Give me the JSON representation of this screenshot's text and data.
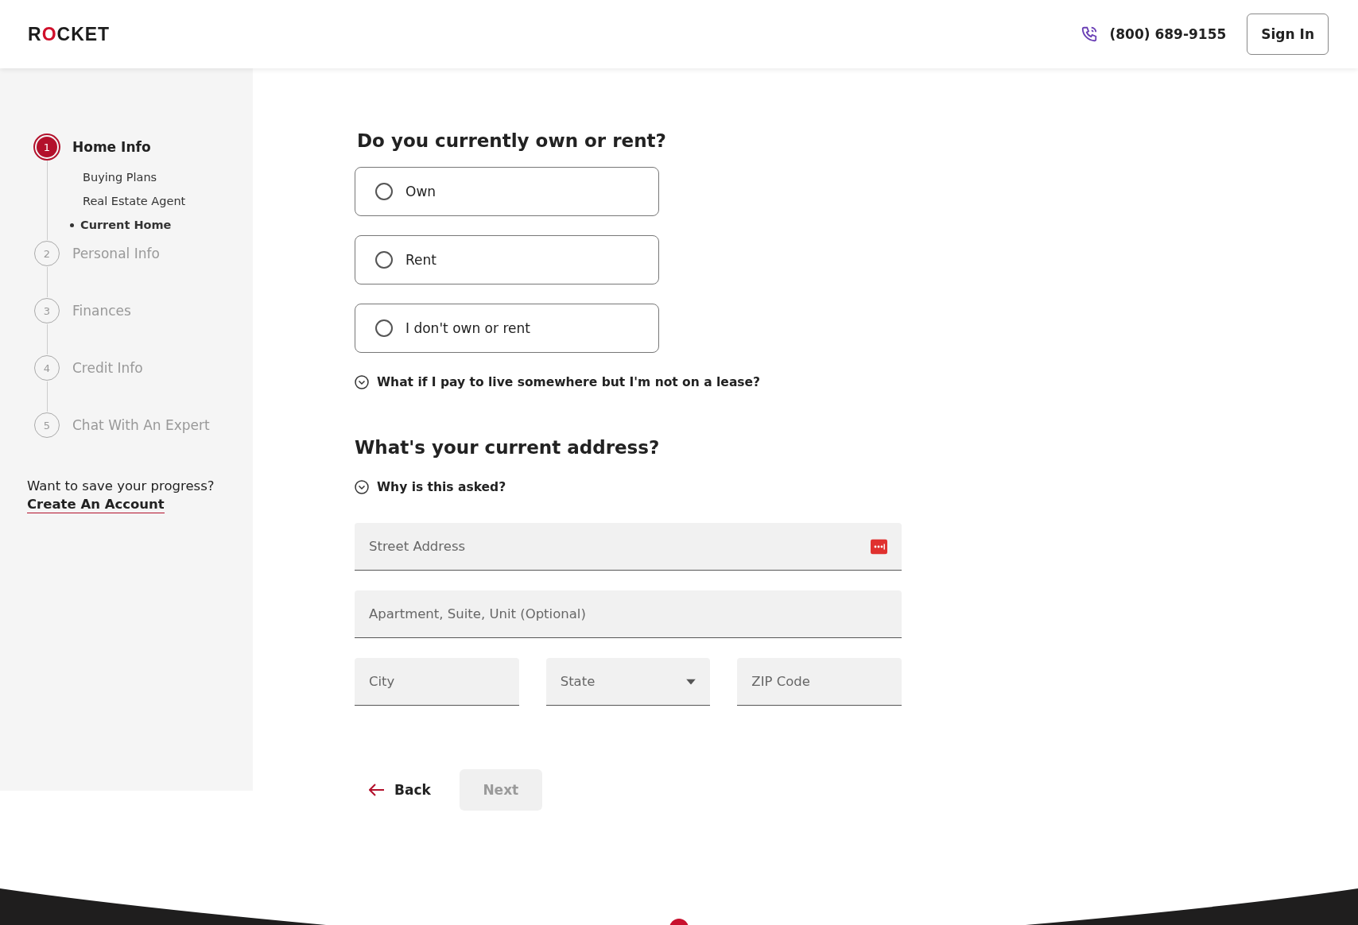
{
  "header": {
    "logo": "ROCKET",
    "phone": "(800) 689-9155",
    "sign_in": "Sign In"
  },
  "sidebar": {
    "steps": [
      {
        "number": "1",
        "label": "Home Info",
        "selected": true,
        "children": [
          {
            "label": "Buying Plans",
            "selected": false
          },
          {
            "label": "Real Estate Agent",
            "selected": false
          },
          {
            "label": "Current Home",
            "selected": true
          }
        ]
      },
      {
        "number": "2",
        "label": "Personal Info",
        "selected": false
      },
      {
        "number": "3",
        "label": "Finances",
        "selected": false
      },
      {
        "number": "4",
        "label": "Credit Info",
        "selected": false
      },
      {
        "number": "5",
        "label": "Chat With An Expert",
        "selected": false
      }
    ],
    "save_prompt": "Want to save your progress?",
    "create_account": "Create An Account"
  },
  "sections": [
    {
      "kind": "radio",
      "title": "Do you currently own or rent?",
      "options": [
        {
          "label": "Own",
          "selected": false
        },
        {
          "label": "Rent",
          "selected": false
        },
        {
          "label": "I don't own or rent",
          "selected": false
        }
      ],
      "help": {
        "label": "What if I pay to live somewhere but I'm not on a lease?",
        "expanded": false
      }
    },
    {
      "kind": "address",
      "title": "What's your current address?",
      "help": {
        "label": "Why is this asked?",
        "expanded": false
      },
      "fields": {
        "street": {
          "placeholder": "Street Address"
        },
        "unit": {
          "placeholder": "Apartment, Suite, Unit (Optional)"
        },
        "city": {
          "placeholder": "City"
        },
        "state": {
          "placeholder": "State"
        },
        "zip": {
          "placeholder": "ZIP Code"
        }
      }
    }
  ],
  "actions": {
    "back": "Back",
    "next": {
      "label": "Next",
      "disabled": true
    }
  }
}
